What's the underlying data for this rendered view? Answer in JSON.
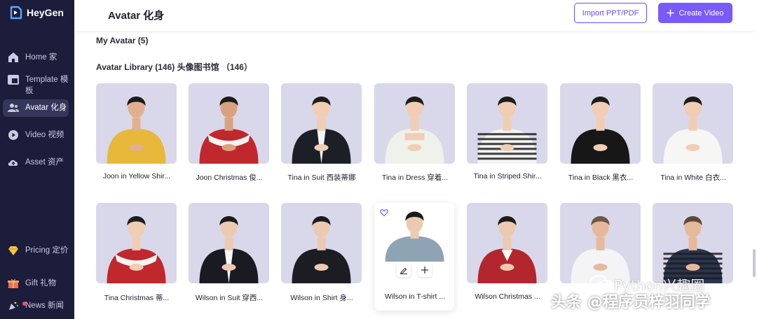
{
  "brand": {
    "name": "HeyGen"
  },
  "sidebar": {
    "items": [
      {
        "label": "Home 家",
        "icon": "home-icon"
      },
      {
        "label": "Template 模板",
        "icon": "template-icon"
      },
      {
        "label": "Avatar 化身",
        "icon": "avatar-icon",
        "active": true
      },
      {
        "label": "Video 视频",
        "icon": "video-icon"
      },
      {
        "label": "Asset 资产",
        "icon": "cloud-icon"
      },
      {
        "label": "Pricing 定价",
        "icon": "diamond-icon"
      },
      {
        "label": "Gift 礼物",
        "icon": "gift-icon"
      },
      {
        "label": "News 新闻",
        "icon": "news-icon"
      }
    ]
  },
  "header": {
    "title": "Avatar 化身",
    "import_label": "Import PPT/PDF",
    "create_label": "Create Video"
  },
  "sections": {
    "my_avatar": "My Avatar (5)",
    "library": "Avatar Library (146) 头像图书馆 （146）"
  },
  "avatars": [
    {
      "label": "Joon in Yellow Shir...",
      "figure": {
        "skin": "#e3b08f",
        "hair": "#1b1b1b",
        "top": "#e8b83a",
        "style": "shirt"
      }
    },
    {
      "label": "Joon Christmas 俊...",
      "figure": {
        "skin": "#d9a17e",
        "hair": "#1b1b1b",
        "top": "#c0282d",
        "style": "santa"
      }
    },
    {
      "label": "Tina in Suit 西装蒂娜",
      "figure": {
        "skin": "#f0cdb3",
        "hair": "#1d1d1d",
        "top": "#1d1f26",
        "style": "suit"
      }
    },
    {
      "label": "Tina in Dress 穿着...",
      "figure": {
        "skin": "#f0cdb3",
        "hair": "#1d1d1d",
        "top": "#eef2ea",
        "style": "dress"
      }
    },
    {
      "label": "Tina in Striped Shir...",
      "figure": {
        "skin": "#f0cdb3",
        "hair": "#1d1d1d",
        "top": "#f3f3f3",
        "style": "stripe"
      }
    },
    {
      "label": "Tina in Black 黑衣...",
      "figure": {
        "skin": "#f0cdb3",
        "hair": "#1d1d1d",
        "top": "#171717",
        "style": "shirt"
      }
    },
    {
      "label": "Tina in White 白衣...",
      "figure": {
        "skin": "#f0cdb3",
        "hair": "#1d1d1d",
        "top": "#f6f6f4",
        "style": "shirt"
      }
    },
    {
      "label": "Tina Christmas 蒂...",
      "figure": {
        "skin": "#f0cdb3",
        "hair": "#1d1d1d",
        "top": "#c0282d",
        "style": "santa"
      }
    },
    {
      "label": "Wilson in Suit 穿西...",
      "figure": {
        "skin": "#eccab1",
        "hair": "#1b1b1b",
        "top": "#1a1b22",
        "style": "suit"
      }
    },
    {
      "label": "Wilson in Shirt 身...",
      "figure": {
        "skin": "#eccab1",
        "hair": "#1b1b1b",
        "top": "#1c1d22",
        "style": "shirt"
      }
    },
    {
      "label": "Wilson in T-shirt ...",
      "figure": {
        "skin": "#eccab1",
        "hair": "#1b1b1b",
        "top": "#8ea3b3",
        "style": "shirt"
      }
    },
    {
      "label": "Wilson Christmas ...",
      "figure": {
        "skin": "#eccab1",
        "hair": "#1b1b1b",
        "top": "#b3262e",
        "style": "sweater"
      }
    },
    {
      "label": "",
      "figure": {
        "skin": "#e6b99a",
        "hair": "#6b5a46",
        "top": "#f4f4f6",
        "style": "shirt"
      }
    },
    {
      "label": "",
      "figure": {
        "skin": "#e6b99a",
        "hair": "#5b4a38",
        "top": "#2a3550",
        "style": "stripe"
      }
    }
  ],
  "watermark": {
    "line1": "Python兴趣圈",
    "line2": "头条 @程序员梓羽同学"
  }
}
